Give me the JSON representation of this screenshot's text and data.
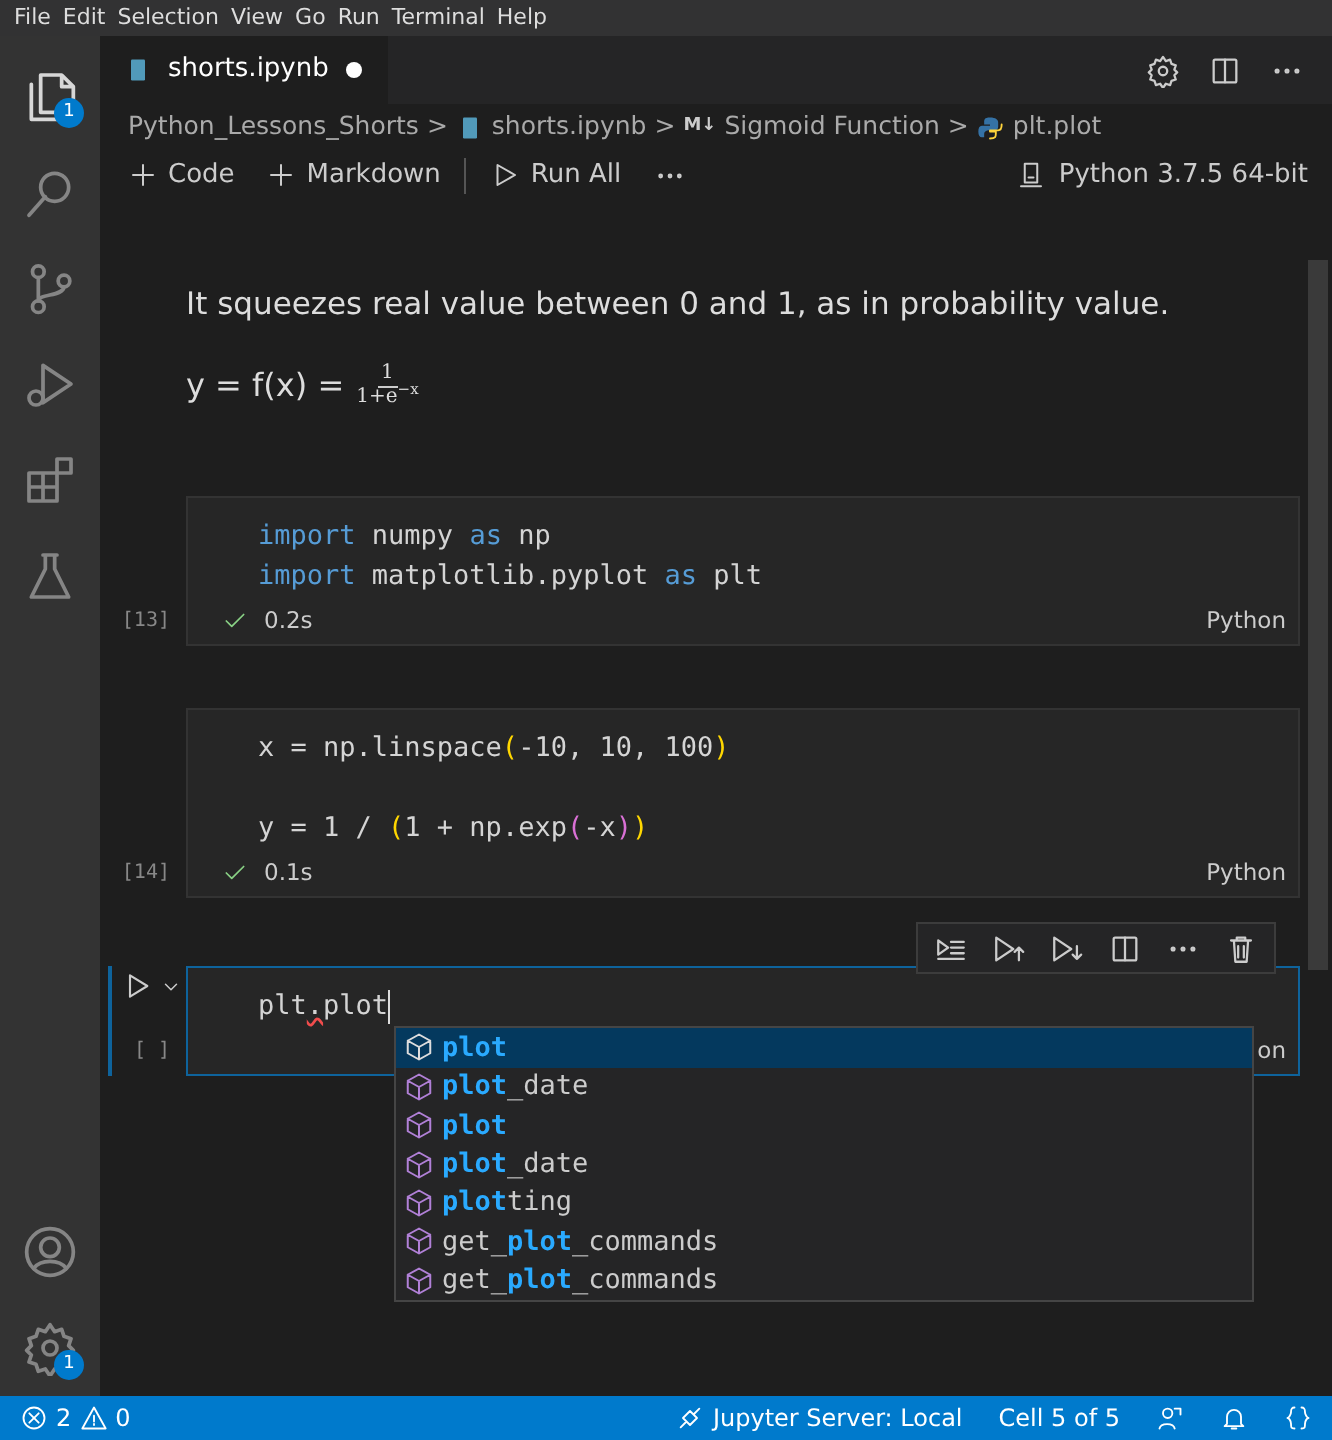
{
  "menu_bar": [
    "File",
    "Edit",
    "Selection",
    "View",
    "Go",
    "Run",
    "Terminal",
    "Help"
  ],
  "activity_bar": {
    "top": [
      {
        "kind": "files",
        "badge": "1"
      },
      {
        "kind": "search"
      },
      {
        "kind": "source-control"
      },
      {
        "kind": "run"
      },
      {
        "kind": "extensions"
      },
      {
        "kind": "testing"
      }
    ],
    "bottom": [
      {
        "kind": "account"
      },
      {
        "kind": "settings",
        "badge": "1"
      }
    ]
  },
  "tabs": [
    {
      "title": "shorts.ipynb",
      "selected": true,
      "modified": true
    }
  ],
  "editor_actions": [
    {
      "kind": "settings"
    },
    {
      "kind": "split"
    },
    {
      "kind": "more"
    }
  ],
  "breadcrumbs": [
    {
      "kind": "folder",
      "text": "Python_Lessons_Shorts",
      "separator": ">"
    },
    {
      "kind": "notebook",
      "text": "shorts.ipynb",
      "separator": ">"
    },
    {
      "kind": "markdown",
      "icon_text": "M↓",
      "text": "Sigmoid Function",
      "separator": ">"
    },
    {
      "kind": "python",
      "text": "plt.plot"
    }
  ],
  "notebook_toolbar": {
    "items": [
      {
        "kind": "add",
        "text": "Code"
      },
      {
        "kind": "add",
        "text": "Markdown"
      },
      {
        "kind": "run-all",
        "text": "Run All"
      },
      {
        "kind": "more"
      }
    ],
    "kernel": "Python 3.7.5 64-bit"
  },
  "markdown": {
    "paragraph": "It squeezes real value between 0 and 1, as in probability value.",
    "formula": {
      "lhs": "y = f(x) =",
      "numerator": "1",
      "denominator": "1+e$^{−x}$"
    }
  },
  "cells": [
    {
      "execution_count": "[13]",
      "focused": false,
      "succeeded": true,
      "duration": "0.2s",
      "language": "Python",
      "lines": [
        {
          "tokens": [
            {
              "text": "import",
              "kind": "keyword"
            },
            {
              "text": " numpy ",
              "kind": "plain"
            },
            {
              "text": "as",
              "kind": "keyword"
            },
            {
              "text": " np",
              "kind": "plain"
            }
          ]
        },
        {
          "tokens": [
            {
              "text": "import",
              "kind": "keyword"
            },
            {
              "text": " matplotlib.pyplot ",
              "kind": "plain"
            },
            {
              "text": "as",
              "kind": "keyword"
            },
            {
              "text": " plt",
              "kind": "plain"
            }
          ]
        }
      ]
    },
    {
      "execution_count": "[14]",
      "focused": false,
      "succeeded": true,
      "duration": "0.1s",
      "language": "Python",
      "lines": [
        {
          "tokens": [
            {
              "text": "x = np.linspace",
              "kind": "plain"
            },
            {
              "text": "(",
              "kind": "paren1"
            },
            {
              "text": "-10, 10, 100",
              "kind": "plain"
            },
            {
              "text": ")",
              "kind": "paren1"
            }
          ]
        },
        {
          "kind": "blank"
        },
        {
          "tokens": [
            {
              "text": "y = 1 / ",
              "kind": "plain"
            },
            {
              "text": "(",
              "kind": "paren1"
            },
            {
              "text": "1 + np.exp",
              "kind": "plain"
            },
            {
              "text": "(",
              "kind": "paren2"
            },
            {
              "text": "-x",
              "kind": "plain"
            },
            {
              "text": ")",
              "kind": "paren2"
            },
            {
              "text": ")",
              "kind": "paren1"
            }
          ]
        }
      ]
    },
    {
      "execution_count": "[ ]",
      "focused": true,
      "language": "on",
      "lines": [
        {
          "tokens": [
            {
              "text": "plt",
              "kind": "plain"
            },
            {
              "text": ".",
              "kind": "error"
            },
            {
              "text": "plot",
              "kind": "plain"
            }
          ]
        }
      ],
      "cell_toolbar": [
        {
          "kind": "run-by-line"
        },
        {
          "kind": "run-above"
        },
        {
          "kind": "run-below"
        },
        {
          "kind": "split"
        },
        {
          "kind": "more"
        },
        {
          "kind": "delete"
        }
      ],
      "suggestions": [
        {
          "selected": true,
          "parts": [
            {
              "text": "plot",
              "match": true
            }
          ]
        },
        {
          "selected": false,
          "parts": [
            {
              "text": "plot",
              "match": true
            },
            {
              "text": "_date",
              "match": false
            }
          ]
        },
        {
          "selected": false,
          "parts": [
            {
              "text": "plot",
              "match": true
            }
          ]
        },
        {
          "selected": false,
          "parts": [
            {
              "text": "plot",
              "match": true
            },
            {
              "text": "_date",
              "match": false
            }
          ]
        },
        {
          "selected": false,
          "parts": [
            {
              "text": "plot",
              "match": true
            },
            {
              "text": "ting",
              "match": false
            }
          ]
        },
        {
          "selected": false,
          "parts": [
            {
              "text": "get_",
              "match": false
            },
            {
              "text": "plot",
              "match": true
            },
            {
              "text": "_commands",
              "match": false
            }
          ]
        },
        {
          "selected": false,
          "parts": [
            {
              "text": "get_",
              "match": false
            },
            {
              "text": "plot",
              "match": true
            },
            {
              "text": "_commands",
              "match": false
            }
          ]
        }
      ]
    }
  ],
  "status_bar": {
    "errors": "2",
    "warnings": "0",
    "items": [
      {
        "kind": "server",
        "text": "Jupyter Server: Local"
      },
      {
        "kind": "text",
        "text": "Cell 5 of 5"
      },
      {
        "kind": "feedback"
      },
      {
        "kind": "bell"
      },
      {
        "kind": "braces"
      }
    ]
  }
}
